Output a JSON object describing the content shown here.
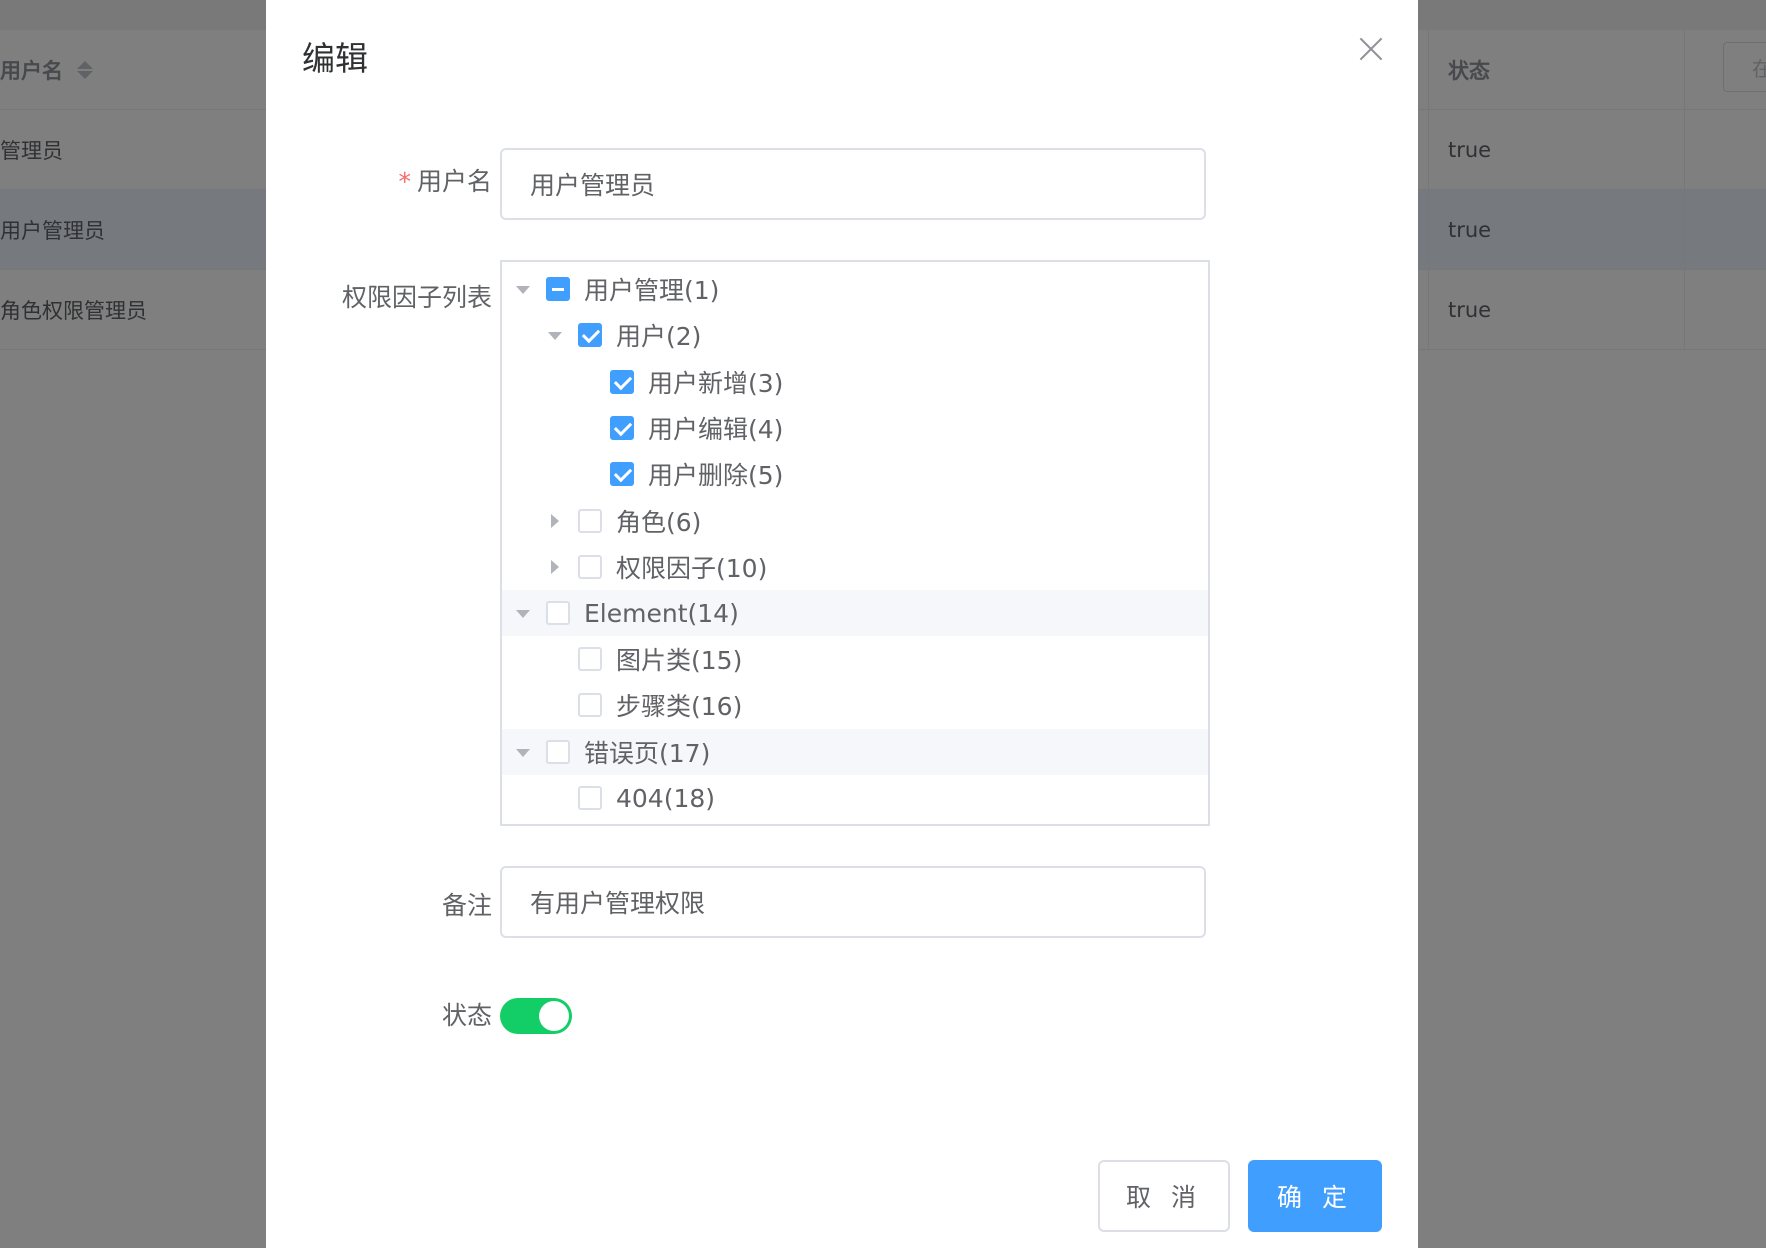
{
  "table": {
    "headers": {
      "username": "用户名",
      "status": "状态",
      "action_partial": "在"
    },
    "rows": [
      {
        "username": "管理员",
        "status": "true"
      },
      {
        "username": "用户管理员",
        "status": "true"
      },
      {
        "username": "角色权限管理员",
        "status": "true"
      }
    ]
  },
  "dialog": {
    "title": "编辑",
    "fields": {
      "username": {
        "label": "用户名",
        "value": "用户管理员"
      },
      "permissions": {
        "label": "权限因子列表"
      },
      "remark": {
        "label": "备注",
        "value": "有用户管理权限"
      },
      "status": {
        "label": "状态",
        "enabled": true
      }
    },
    "tree": [
      {
        "label": "用户管理(1)",
        "state": "indeterminate",
        "expanded": true
      },
      {
        "label": "用户(2)",
        "state": "checked",
        "expanded": true
      },
      {
        "label": "用户新增(3)",
        "state": "checked"
      },
      {
        "label": "用户编辑(4)",
        "state": "checked"
      },
      {
        "label": "用户删除(5)",
        "state": "checked"
      },
      {
        "label": "角色(6)",
        "state": "unchecked",
        "expanded": false
      },
      {
        "label": "权限因子(10)",
        "state": "unchecked",
        "expanded": false
      },
      {
        "label": "Element(14)",
        "state": "unchecked",
        "expanded": true
      },
      {
        "label": "图片类(15)",
        "state": "unchecked"
      },
      {
        "label": "步骤类(16)",
        "state": "unchecked"
      },
      {
        "label": "错误页(17)",
        "state": "unchecked",
        "expanded": true
      },
      {
        "label": "404(18)",
        "state": "unchecked"
      }
    ],
    "buttons": {
      "cancel": "取 消",
      "confirm": "确 定"
    }
  },
  "colors": {
    "primary": "#409eff",
    "switch_on": "#13ce66",
    "required": "#f56c6c"
  }
}
